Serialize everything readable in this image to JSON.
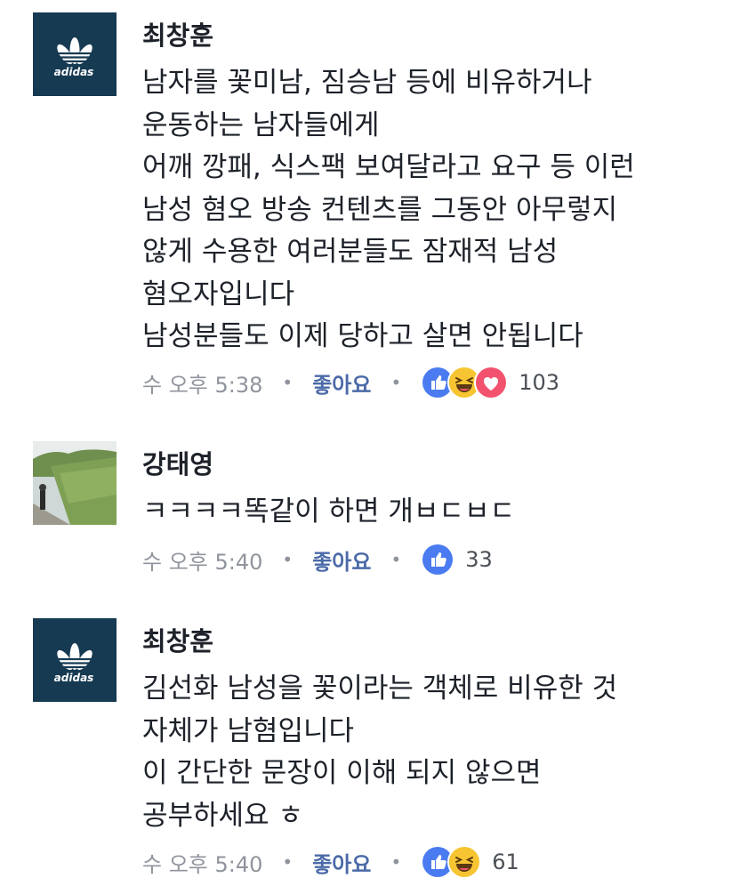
{
  "comments": [
    {
      "author": "최창훈",
      "avatar_brand": "adidas",
      "lines": [
        "남자를 꽃미남, 짐승남 등에 비유하거나",
        "운동하는 남자들에게",
        "어깨 깡패, 식스팩 보여달라고 요구 등 이런",
        "남성 혐오 방송 컨텐츠를 그동안 아무렇지",
        "않게 수용한 여러분들도 잠재적 남성",
        "혐오자입니다",
        "남성분들도 이제 당하고 살면 안됩니다"
      ],
      "time": "수 오후 5:38",
      "like_label": "좋아요",
      "reactions": [
        "like",
        "haha",
        "love"
      ],
      "reaction_count": "103"
    },
    {
      "author": "강태영",
      "avatar_brand": "",
      "lines": [
        "ㅋㅋㅋㅋ똑같이 하면 개ㅂㄷㅂㄷ"
      ],
      "time": "수 오후 5:40",
      "like_label": "좋아요",
      "reactions": [
        "like"
      ],
      "reaction_count": "33"
    },
    {
      "author": "최창훈",
      "avatar_brand": "adidas",
      "lines": [
        "김선화 남성을 꽃이라는 객체로 비유한 것",
        "자체가 남혐입니다",
        "이 간단한 문장이 이해 되지 않으면",
        "공부하세요 ㅎ"
      ],
      "time": "수 오후 5:40",
      "like_label": "좋아요",
      "reactions": [
        "like",
        "haha"
      ],
      "reaction_count": "61"
    }
  ],
  "separator": "•",
  "colors": {
    "like": "#4b7bf0",
    "haha": "#f7c531",
    "love": "#f2526e",
    "link": "#4b6aa8",
    "meta": "#90949c",
    "adidas_bg": "#163a52"
  }
}
